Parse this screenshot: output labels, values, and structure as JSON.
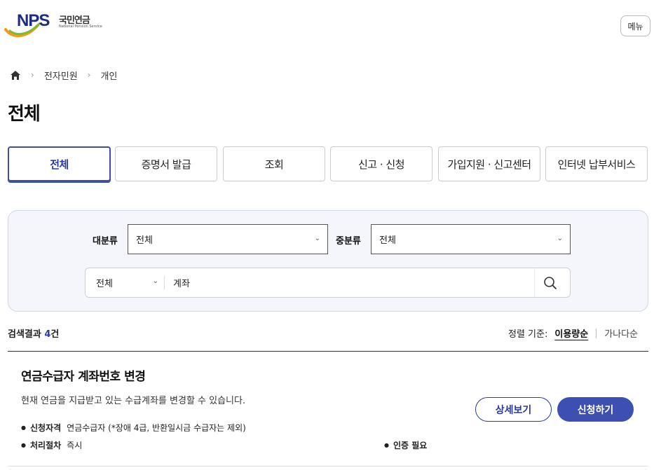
{
  "header": {
    "logo_letters": "NPS",
    "logo_ko": "국민연금",
    "logo_en": "National Pension Service",
    "menu_label": "메뉴"
  },
  "breadcrumb": {
    "home_icon": "home-icon",
    "items": [
      "전자민원",
      "개인"
    ]
  },
  "page_title": "전체",
  "tabs": [
    {
      "label": "전체",
      "active": true
    },
    {
      "label": "증명서 발급",
      "active": false
    },
    {
      "label": "조회",
      "active": false
    },
    {
      "label": "신고 · 신청",
      "active": false
    },
    {
      "label": "가입지원 · 신고센터",
      "active": false
    },
    {
      "label": "인터넷 납부서비스",
      "active": false
    }
  ],
  "filters": {
    "major_label": "대분류",
    "major_value": "전체",
    "middle_label": "중분류",
    "middle_value": "전체",
    "search_category": "전체",
    "search_value": "계좌",
    "search_icon": "search-icon"
  },
  "results": {
    "prefix": "검색결과",
    "count": "4",
    "suffix": "건",
    "sort_label": "정렬 기준:",
    "sort_active": "이용량순",
    "sort_other": "가나다순"
  },
  "item": {
    "title": "연금수급자 계좌번호 변경",
    "desc": "현재 연금을 지급받고 있는 수급계좌를 변경할 수 있습니다.",
    "eligibility_key": "신청자격",
    "eligibility_value": "연금수급자 (*장애 4급, 반환일시금 수급자는 제외)",
    "process_key": "처리절차",
    "process_value": "즉시",
    "auth_key": "인증 필요",
    "detail_button": "상세보기",
    "apply_button": "신청하기"
  },
  "colors": {
    "brand_navy": "#1c2c86",
    "accent_blue": "#3d4fb0",
    "logo_orange": "#f29a1f",
    "logo_green": "#7dbb2f"
  }
}
